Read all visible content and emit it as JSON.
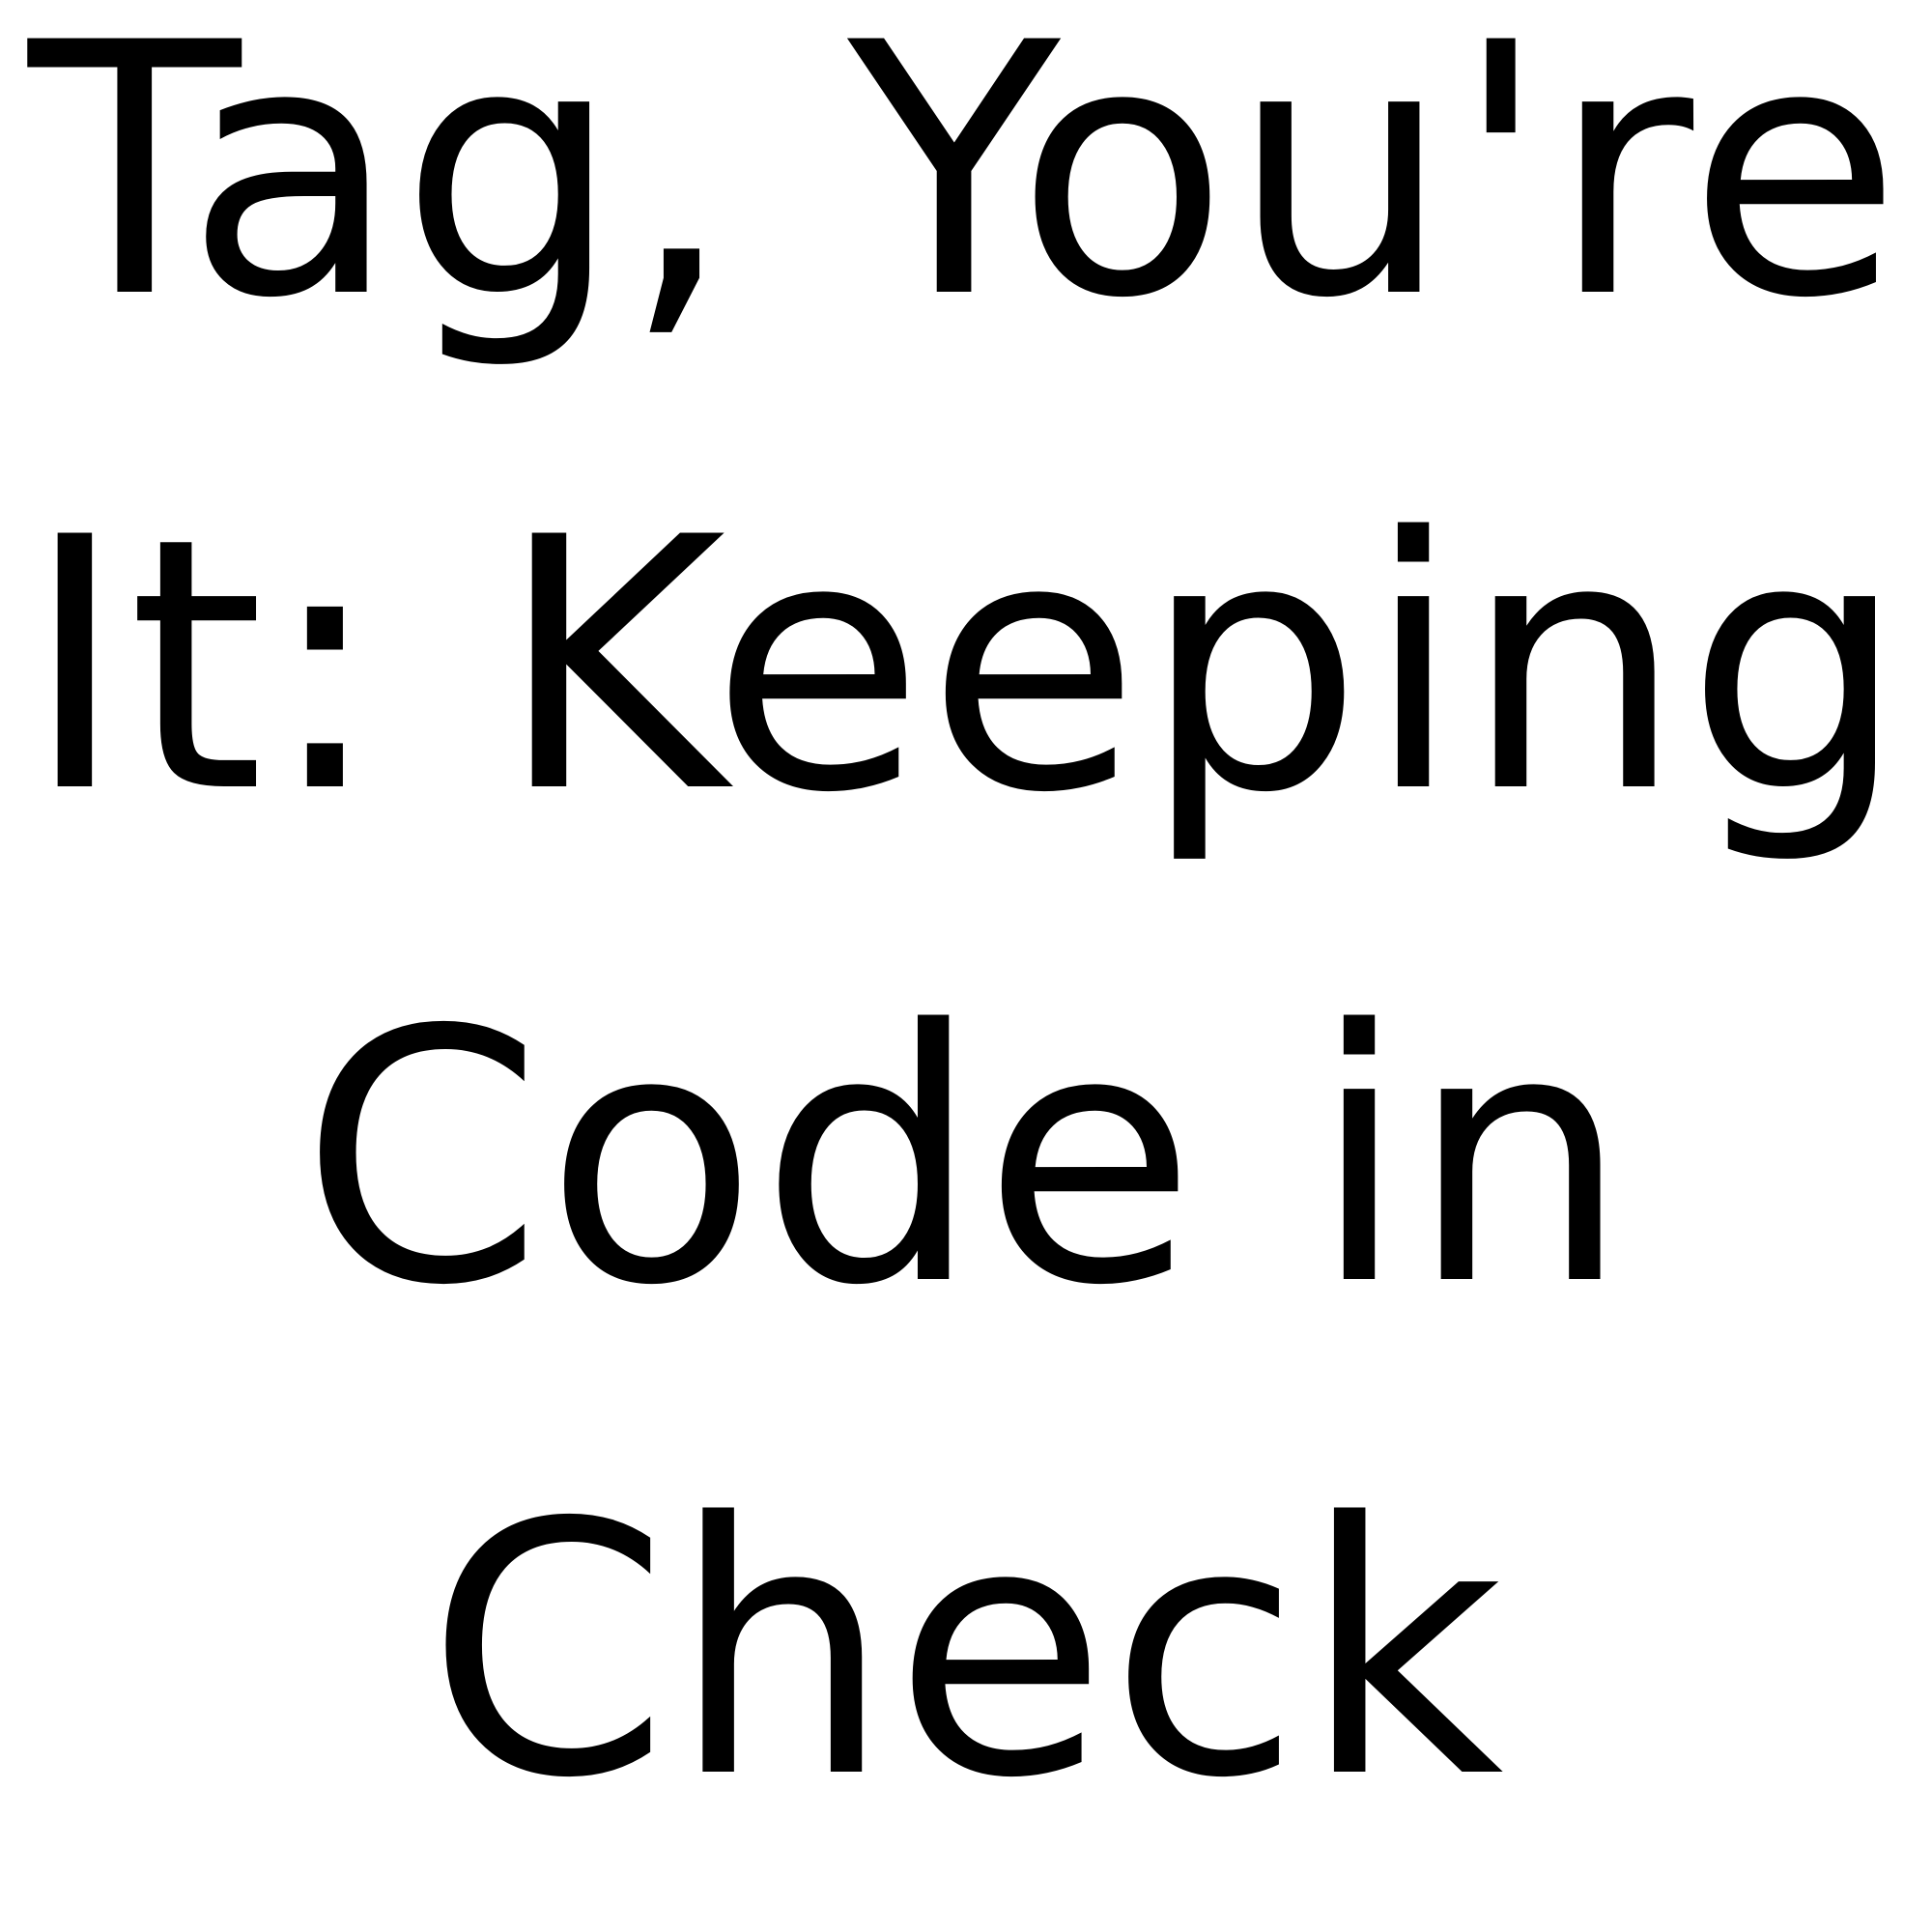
{
  "title": {
    "lines": [
      "Tag, You're",
      "It: Keeping",
      "Code in",
      "Check"
    ],
    "color": "#000000",
    "background": "#ffffff"
  }
}
